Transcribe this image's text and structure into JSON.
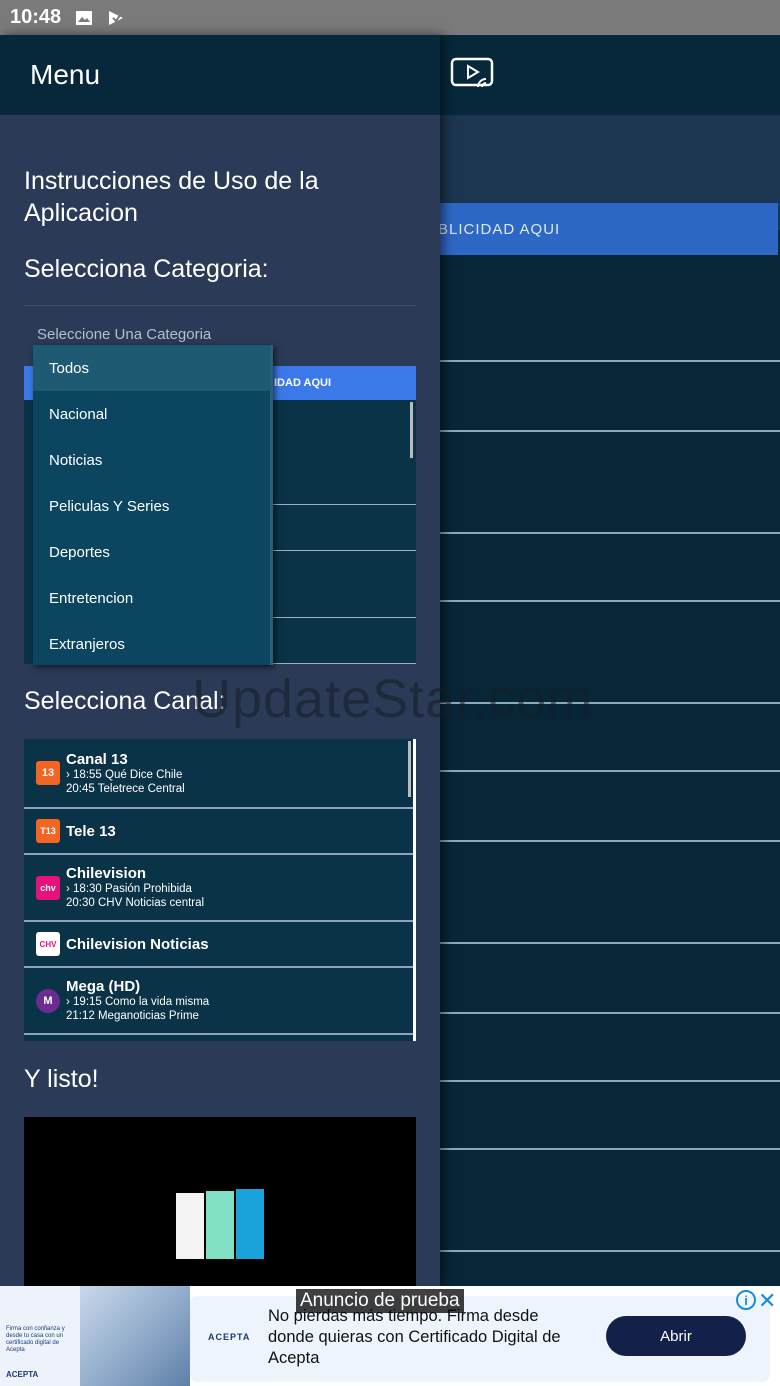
{
  "status": {
    "time": "10:48"
  },
  "background": {
    "ad_text": "BLICIDAD AQUI"
  },
  "drawer": {
    "title": "Menu",
    "instructions_title": "Instrucciones de Uso de la Aplicacion",
    "category_title": "Selecciona Categoria:",
    "category_placeholder": "Seleccione Una Categoria",
    "mini_ad_text": "IDAD AQUI",
    "categories": [
      "Todos",
      "Nacional",
      "Noticias",
      "Peliculas Y Series",
      "Deportes",
      "Entretencion",
      "Extranjeros"
    ],
    "channel_title": "Selecciona Canal:",
    "channels": [
      {
        "name": "Canal 13",
        "prog1": "18:55 Qué Dice Chile",
        "prog2": "20:45 Teletrece Central",
        "logo_text": "13"
      },
      {
        "name": "Tele 13",
        "logo_text": "T13"
      },
      {
        "name": "Chilevision",
        "prog1": "18:30 Pasión Prohibida",
        "prog2": "20:30 CHV Noticias central",
        "logo_text": "chv"
      },
      {
        "name": "Chilevision Noticias",
        "logo_text": "CHV"
      },
      {
        "name": "Mega (HD)",
        "prog1": "19:15 Como la vida misma",
        "prog2": "21:12 Meganoticias Prime",
        "logo_text": "M"
      }
    ],
    "done_title": "Y listo!"
  },
  "watermark": "UpdateStar.com",
  "ad": {
    "label": "Anuncio de prueba",
    "text": "No pierdas más tiempo. Firma desde donde quieras con Certificado Digital de Acepta",
    "button": "Abrir",
    "brand": "ACEPTA",
    "thumb_text": "Firma con confianza y desde tu casa con un certificado digital de Acepta"
  },
  "colors": {
    "drawer_bg": "#2b3a56",
    "header_bg": "#06283a",
    "accent_blue": "#3b79e8",
    "ad_button": "#12204a"
  }
}
